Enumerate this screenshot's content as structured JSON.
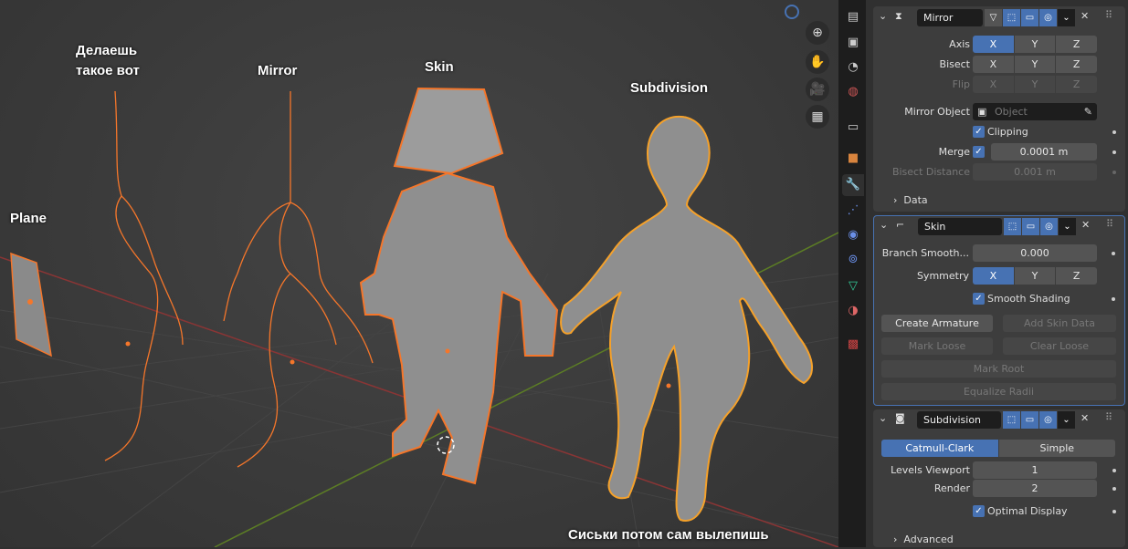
{
  "viewport": {
    "annotations": {
      "plane": "Plane",
      "make_this": "Делаешь\nтакое вот",
      "mirror": "Mirror",
      "skin": "Skin",
      "subdivision": "Subdivision",
      "bottom_note": "Сиськи потом сам вылепишь"
    },
    "nav_icons": [
      "zoom-icon",
      "hand-pan-icon",
      "camera-icon",
      "grid-perspective-icon"
    ]
  },
  "colors": {
    "accent": "#4772b3",
    "selection": "#f5762a",
    "active_selection": "#f5a12a",
    "x_axis": "#9b3a3a",
    "y_axis": "#6a8f2a"
  },
  "tabs": [
    "tool",
    "render",
    "output",
    "view-layer",
    "scene",
    "world",
    "collection",
    "object",
    "modifiers",
    "particles",
    "physics",
    "constraints",
    "data",
    "material",
    "texture"
  ],
  "mirror": {
    "name": "Mirror",
    "axis_label": "Axis",
    "bisect_label": "Bisect",
    "flip_label": "Flip",
    "axes": [
      "X",
      "Y",
      "Z"
    ],
    "mirror_object_label": "Mirror Object",
    "mirror_object_placeholder": "Object",
    "clipping_label": "Clipping",
    "clipping": true,
    "merge_label": "Merge",
    "merge": true,
    "merge_value": "0.0001 m",
    "bisect_distance_label": "Bisect Distance",
    "bisect_distance_value": "0.001 m",
    "data_label": "Data"
  },
  "skin": {
    "name": "Skin",
    "branch_label": "Branch Smooth...",
    "branch_value": "0.000",
    "symmetry_label": "Symmetry",
    "axes": [
      "X",
      "Y",
      "Z"
    ],
    "smooth_label": "Smooth Shading",
    "smooth": true,
    "create_armature": "Create Armature",
    "add_skin_data": "Add Skin Data",
    "mark_loose": "Mark Loose",
    "clear_loose": "Clear Loose",
    "mark_root": "Mark Root",
    "equalize_radii": "Equalize Radii"
  },
  "subdivision": {
    "name": "Subdivision",
    "catmull": "Catmull-Clark",
    "simple": "Simple",
    "levels_label": "Levels Viewport",
    "levels_value": "1",
    "render_label": "Render",
    "render_value": "2",
    "optimal_label": "Optimal Display",
    "optimal": true,
    "advanced_label": "Advanced"
  }
}
